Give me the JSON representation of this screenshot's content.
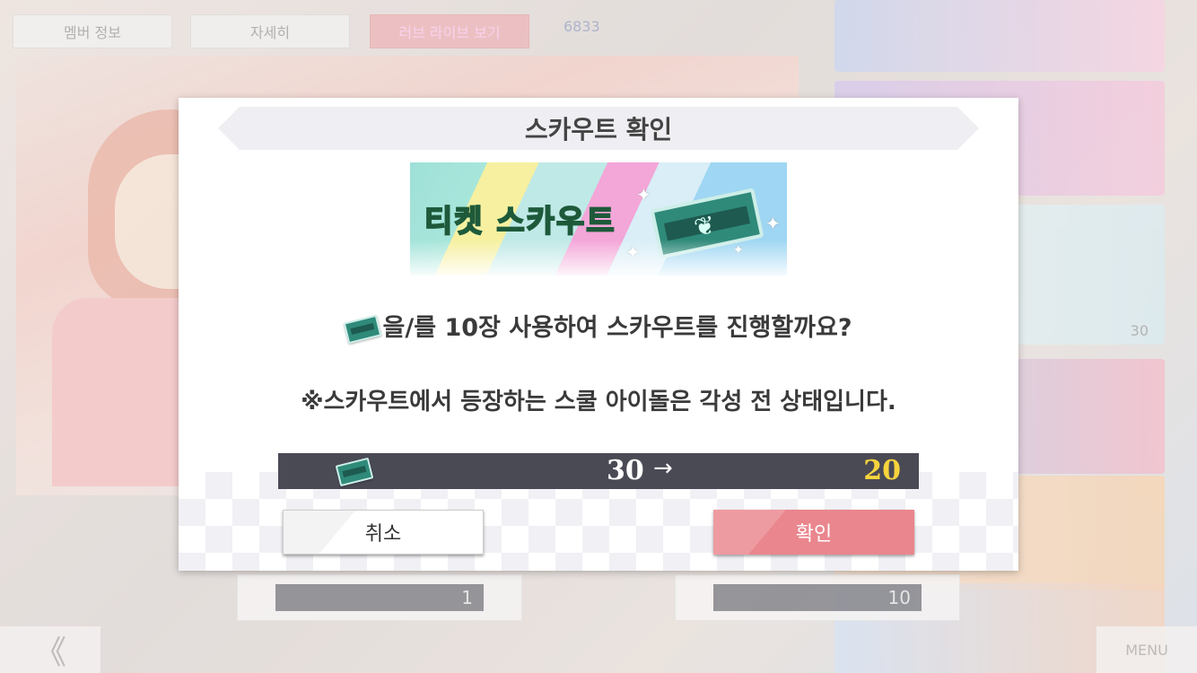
{
  "background": {
    "tabs": [
      "멤버 정보",
      "자세히",
      "러브 라이브 보기"
    ],
    "loveca_count": "6833",
    "bottom_cards": [
      {
        "count": "1"
      },
      {
        "count": "10"
      }
    ],
    "right_card_count": "30",
    "back_label": "《",
    "menu_label": "MENU"
  },
  "dialog": {
    "title": "스카우트 확인",
    "banner_text": "티켓 스카우트",
    "message_line1": "을/를 10장 사용하여 스카우트를 진행할까요?",
    "message_line2": "※스카우트에서 등장하는 스쿨 아이돌은 각성 전 상태입니다.",
    "cost": {
      "from": "30",
      "arrow": "→",
      "to": "20"
    },
    "cancel_label": "취소",
    "confirm_label": "확인"
  },
  "colors": {
    "confirm_button": "#ea868d",
    "cost_bar": "#4a4a55",
    "cost_after": "#f7d43d",
    "ticket": "#2f8a7a"
  }
}
